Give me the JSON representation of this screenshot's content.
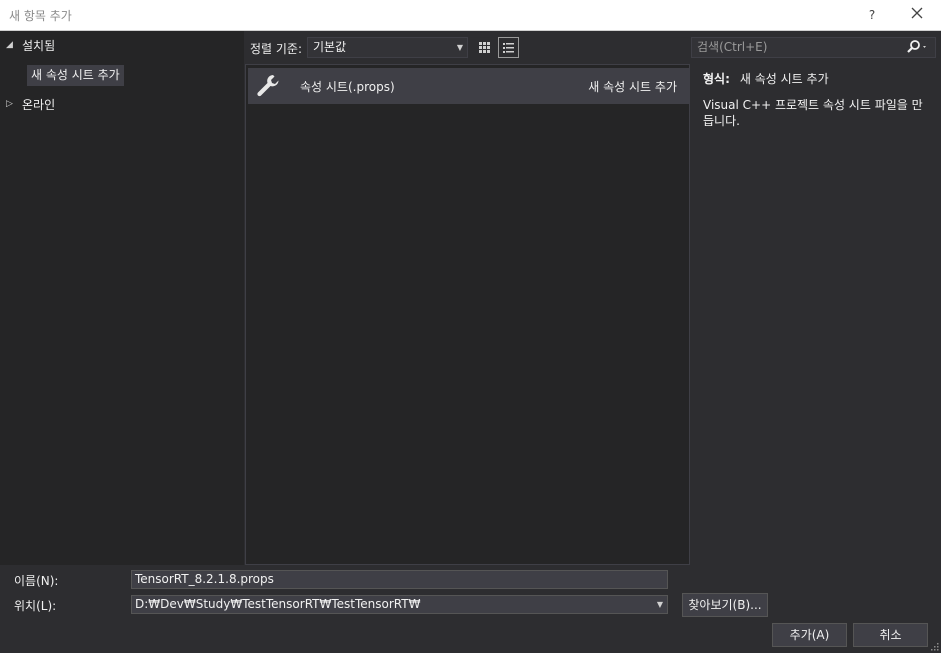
{
  "window": {
    "title": "새 항목 추가",
    "help_label": "?",
    "close_icon": "close-icon"
  },
  "sidebar": {
    "installed_label": "설치됨",
    "installed_child": "새 속성 시트 추가",
    "online_label": "온라인"
  },
  "toolbar": {
    "sort_label": "정렬 기준:",
    "sort_value": "기본값",
    "grid_view_icon": "grid-view-icon",
    "list_view_icon": "list-view-icon"
  },
  "search": {
    "placeholder": "검색(Ctrl+E)",
    "icon": "search-icon"
  },
  "templates": [
    {
      "name": "속성 시트(.props)",
      "type": "새 속성 시트 추가",
      "icon": "wrench-icon"
    }
  ],
  "details": {
    "type_label": "형식:",
    "type_value": "새 속성 시트 추가",
    "description": "Visual C++ 프로젝트 속성 시트 파일을 만듭니다."
  },
  "form": {
    "name_label": "이름(N):",
    "name_value": "TensorRT_8.2.1.8.props",
    "location_label": "위치(L):",
    "location_value": "D:₩Dev₩Study₩TestTensorRT₩TestTensorRT₩",
    "browse_label": "찾아보기(B)...",
    "add_label": "추가(A)",
    "cancel_label": "취소"
  }
}
